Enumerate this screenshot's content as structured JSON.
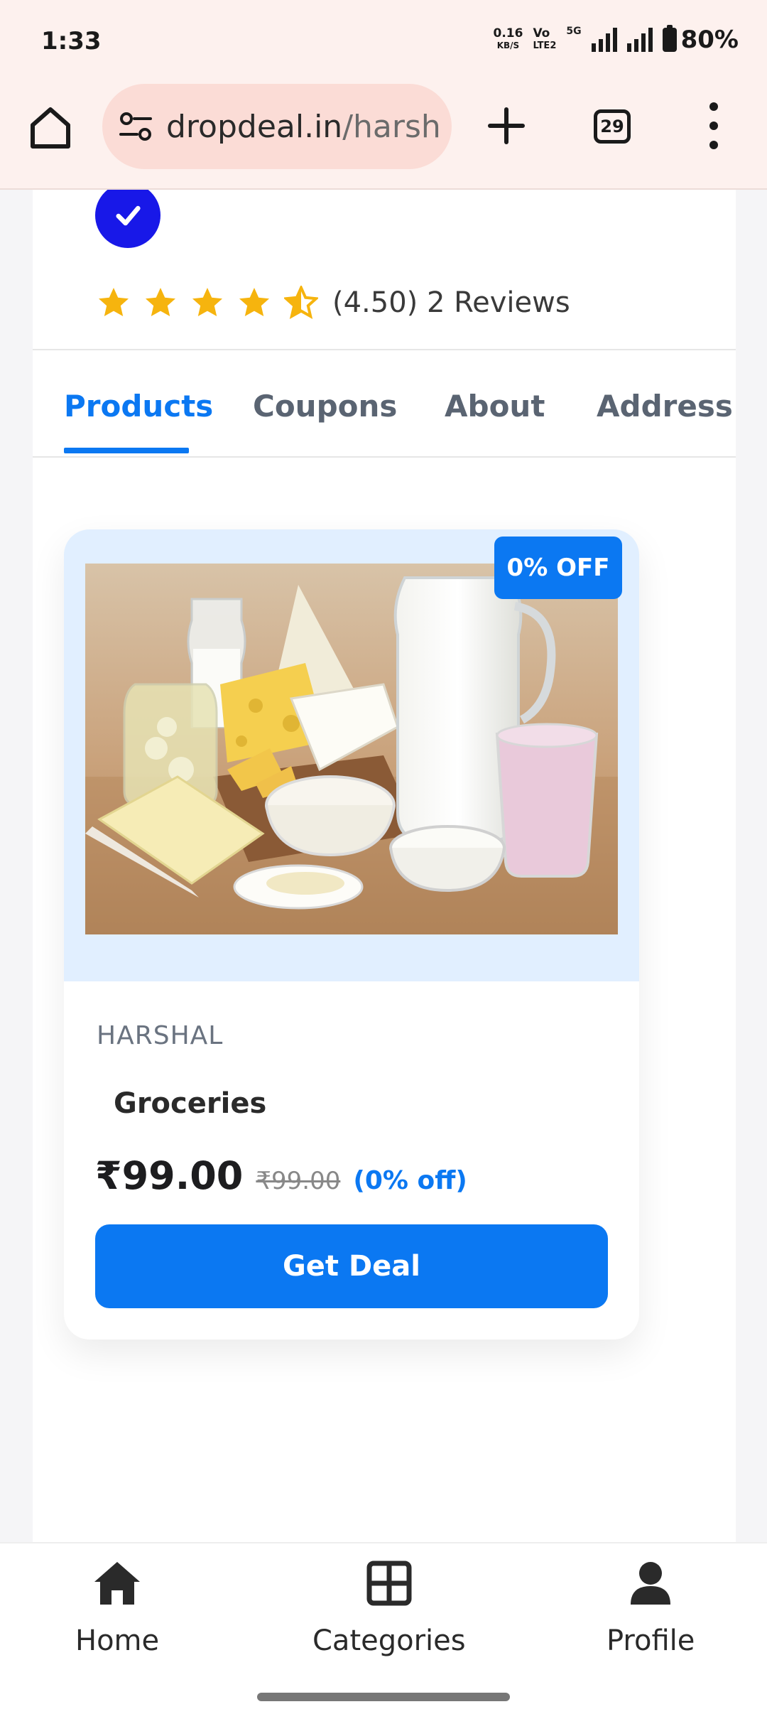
{
  "status_bar": {
    "time": "1:33",
    "net_speed_value": "0.16",
    "net_speed_unit": "KB/S",
    "volte_top": "Vo",
    "volte_bottom": "LTE2",
    "network_label": "5G",
    "battery": "80%"
  },
  "browser": {
    "url_domain": "dropdeal.in",
    "url_path": "/harsh",
    "tab_count": "29"
  },
  "store": {
    "rating_value": 4.5,
    "rating_text": "(4.50) 2 Reviews"
  },
  "tabs": [
    {
      "label": "Products",
      "active": true
    },
    {
      "label": "Coupons",
      "active": false
    },
    {
      "label": "About",
      "active": false
    },
    {
      "label": "Address",
      "active": false
    }
  ],
  "product": {
    "badge": "0% OFF",
    "store_name": "HARSHAL",
    "name": "Groceries",
    "price": "₹99.00",
    "old_price": "₹99.00",
    "discount": "(0% off)",
    "cta": "Get Deal"
  },
  "bottom_nav": [
    {
      "label": "Home",
      "icon": "home-icon"
    },
    {
      "label": "Categories",
      "icon": "grid-icon"
    },
    {
      "label": "Profile",
      "icon": "person-icon"
    }
  ],
  "colors": {
    "accent": "#0b78f2",
    "verified": "#1818e8",
    "star": "#f6b40e",
    "chrome_bg": "#fdf1ee",
    "urlbar_bg": "#fbdcd6",
    "card_image_bg": "#e1efff"
  }
}
